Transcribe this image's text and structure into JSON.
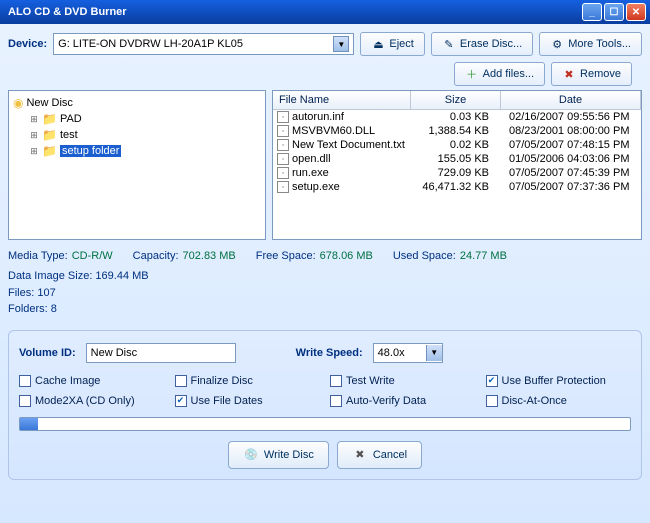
{
  "title": "ALO CD & DVD Burner",
  "device_label": "Device:",
  "device_value": "G: LITE-ON DVDRW LH-20A1P KL05",
  "top_buttons": {
    "eject": "Eject",
    "erase": "Erase Disc...",
    "more": "More Tools..."
  },
  "file_buttons": {
    "add": "Add files...",
    "remove": "Remove"
  },
  "tree": {
    "root": "New Disc",
    "items": [
      {
        "label": "PAD",
        "selected": false
      },
      {
        "label": "test",
        "selected": false
      },
      {
        "label": "setup folder",
        "selected": true
      }
    ]
  },
  "columns": {
    "name": "File Name",
    "size": "Size",
    "date": "Date"
  },
  "files": [
    {
      "name": "autorun.inf",
      "size": "0.03 KB",
      "date": "02/16/2007 09:55:56 PM"
    },
    {
      "name": "MSVBVM60.DLL",
      "size": "1,388.54 KB",
      "date": "08/23/2001 08:00:00 PM"
    },
    {
      "name": "New Text Document.txt",
      "size": "0.02 KB",
      "date": "07/05/2007 07:48:15 PM"
    },
    {
      "name": "open.dll",
      "size": "155.05 KB",
      "date": "01/05/2006 04:03:06 PM"
    },
    {
      "name": "run.exe",
      "size": "729.09 KB",
      "date": "07/05/2007 07:45:39 PM"
    },
    {
      "name": "setup.exe",
      "size": "46,471.32 KB",
      "date": "07/05/2007 07:37:36 PM"
    }
  ],
  "stats": {
    "media_type_label": "Media Type:",
    "media_type": "CD-R/W",
    "capacity_label": "Capacity:",
    "capacity": "702.83 MB",
    "free_label": "Free Space:",
    "free": "678.06 MB",
    "used_label": "Used Space:",
    "used": "24.77 MB",
    "data_image": "Data Image Size: 169.44 MB",
    "files": "Files: 107",
    "folders": "Folders: 8"
  },
  "form": {
    "volume_label": "Volume ID:",
    "volume_value": "New Disc",
    "speed_label": "Write Speed:",
    "speed_value": "48.0x"
  },
  "checks": {
    "cache": "Cache Image",
    "finalize": "Finalize Disc",
    "test": "Test Write",
    "buffer": "Use Buffer Protection",
    "mode2xa": "Mode2XA (CD Only)",
    "filedates": "Use File Dates",
    "autoverify": "Auto-Verify Data",
    "dao": "Disc-At-Once"
  },
  "checked": {
    "buffer": true,
    "filedates": true
  },
  "bottom": {
    "write": "Write Disc",
    "cancel": "Cancel"
  }
}
